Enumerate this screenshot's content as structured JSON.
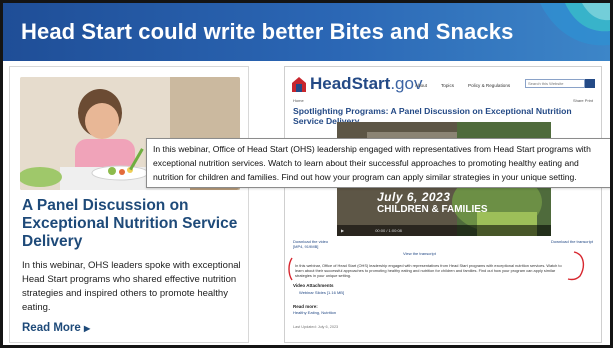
{
  "slide": {
    "title": "Head Start could write better Bites and Snacks"
  },
  "left_card": {
    "heading": "A Panel Discussion on Exceptional Nutrition Service Delivery",
    "description": "In this webinar, OHS leaders spoke with exceptional Head Start programs who shared effective nutrition strategies and inspired others to promote healthy eating.",
    "read_more": "Read More",
    "read_more_icon": "caret-right-icon"
  },
  "website": {
    "logo_main": "HeadStart",
    "logo_suffix": ".gov",
    "nav": [
      "About",
      "Topics",
      "Policy & Regulations"
    ],
    "search_placeholder": "Search this Website",
    "breadcrumb": "Home",
    "share": "Share  Print",
    "page_title": "Spotlighting Programs: A Panel Discussion on Exceptional Nutrition Service Delivery",
    "video_date": "July 6, 2023",
    "video_brand": "CHILDREN & FAMILIES",
    "video_time": "00:00 / 1:00:08",
    "download_video": "Download the video",
    "download_video_size": "[MP4, 919MB]",
    "download_transcript": "Download the transcript",
    "view_transcript": "View the transcript",
    "paragraph": "In this webinar, Office of Head Start (OHS) leadership engaged with representatives from Head Start programs with exceptional nutrition services. Watch to learn about their successful approaches to promoting healthy eating and nutrition for children and families. Find out how your program can apply similar strategies in your unique setting.",
    "video_attachments_title": "Video Attachments",
    "video_attachment_item": "Webinar Slides [1.16 MB]",
    "read_more_title": "Read more:",
    "read_more_links": "Healthy Eating, Nutrition",
    "last_updated": "Last Updated: July 6, 2023"
  },
  "callout": {
    "text": "In this webinar, Office of Head Start (OHS) leadership engaged with representatives from Head Start programs with exceptional nutrition services. Watch to learn about their successful approaches to promoting healthy eating and nutrition for children and families. Find out how your program can apply similar strategies in your unique setting."
  },
  "colors": {
    "header_blue": "#2b67b5",
    "heading_navy": "#1e4a79",
    "annotation_red": "#d7262e",
    "accent_teal": "#35b6c9"
  }
}
